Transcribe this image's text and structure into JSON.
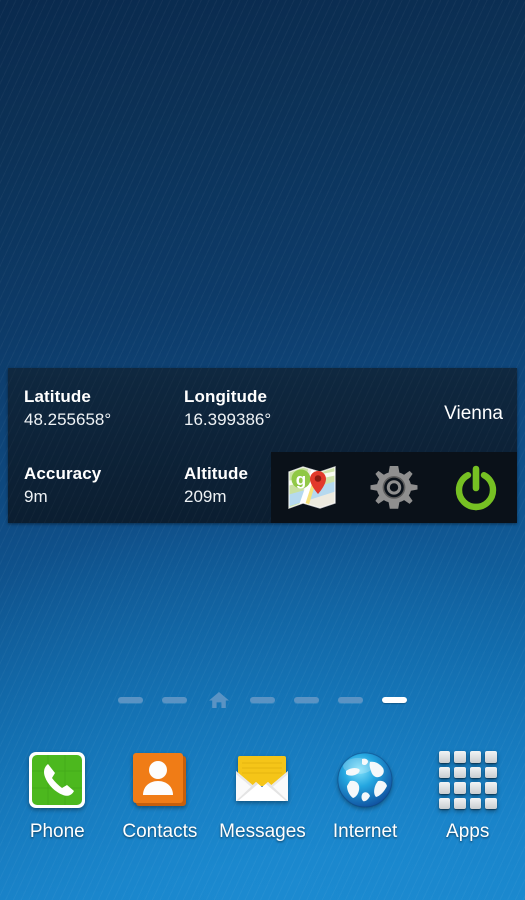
{
  "widget": {
    "fields": [
      {
        "label": "Latitude",
        "value": "48.255658°"
      },
      {
        "label": "Longitude",
        "value": "16.399386°"
      },
      {
        "label": "Accuracy",
        "value": "9m"
      },
      {
        "label": "Altitude",
        "value": "209m"
      }
    ],
    "city": "Vienna",
    "actions": [
      {
        "name": "maps-icon",
        "label": "Maps"
      },
      {
        "name": "settings-icon",
        "label": "Settings"
      },
      {
        "name": "power-icon",
        "label": "Power"
      }
    ],
    "colors": {
      "panel_top": "#0f2840",
      "panel_bottom": "#0b1e31",
      "action_strip": "#0a1119",
      "power_green": "#76c023",
      "gear_gray": "#8c8c8c"
    }
  },
  "page_indicator": {
    "pages": [
      {
        "type": "dash",
        "active": false
      },
      {
        "type": "dash",
        "active": false
      },
      {
        "type": "home",
        "active": false
      },
      {
        "type": "dash",
        "active": false
      },
      {
        "type": "dash",
        "active": false
      },
      {
        "type": "dash",
        "active": false
      },
      {
        "type": "dash",
        "active": true
      }
    ],
    "active_index": 6,
    "total": 7
  },
  "dock": {
    "items": [
      {
        "label": "Phone",
        "icon": "phone-icon",
        "color": "#4cb81e"
      },
      {
        "label": "Contacts",
        "icon": "contacts-icon",
        "color": "#f07c16"
      },
      {
        "label": "Messages",
        "icon": "messages-icon",
        "color": "#f5c518"
      },
      {
        "label": "Internet",
        "icon": "internet-icon",
        "color": "#1a9edd"
      },
      {
        "label": "Apps",
        "icon": "apps-grid-icon",
        "color": "#dfe3e6"
      }
    ]
  },
  "wallpaper": {
    "top_color": "#0a2a4e",
    "bottom_color": "#1a86cc"
  }
}
